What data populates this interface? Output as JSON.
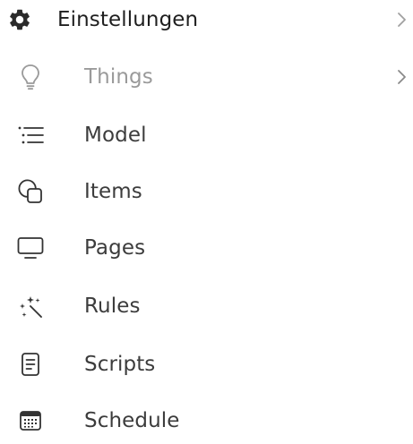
{
  "menu": {
    "header": {
      "label": "Einstellungen",
      "icon": "gear-icon",
      "has_chevron": true
    },
    "items": [
      {
        "label": "Things",
        "icon": "lightbulb-icon",
        "has_chevron": true,
        "muted": true
      },
      {
        "label": "Model",
        "icon": "list-icon"
      },
      {
        "label": "Items",
        "icon": "items-shapes-icon"
      },
      {
        "label": "Pages",
        "icon": "monitor-icon"
      },
      {
        "label": "Rules",
        "icon": "magic-wand-icon"
      },
      {
        "label": "Scripts",
        "icon": "document-icon"
      },
      {
        "label": "Schedule",
        "icon": "calendar-icon"
      }
    ]
  },
  "colors": {
    "text": "#3c3c3c",
    "text_header": "#1f1f1f",
    "text_muted": "#9a9a9a",
    "chevron": "#9a9a9a",
    "icon": "#333333"
  }
}
